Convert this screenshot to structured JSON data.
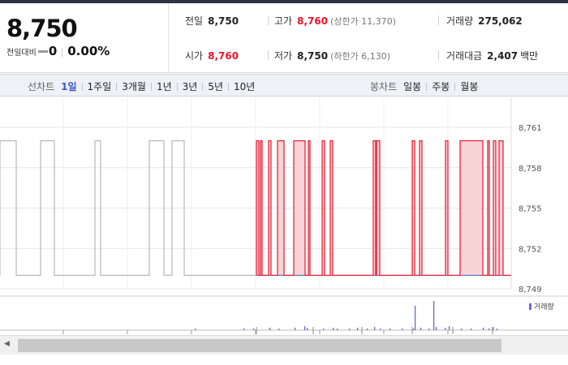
{
  "quote": {
    "price": "8,750",
    "change_label": "전일대비",
    "change_value": "0",
    "change_pct": "0.00%",
    "prev_close": {
      "label": "전일",
      "value": "8,750"
    },
    "open": {
      "label": "시가",
      "value": "8,760"
    },
    "high": {
      "label": "고가",
      "value": "8,760",
      "sub": "(상한가 11,370)"
    },
    "low": {
      "label": "저가",
      "value": "8,750",
      "sub": "(하한가 6,130)"
    },
    "volume": {
      "label": "거래량",
      "value": "275,062"
    },
    "amount": {
      "label": "거래대금",
      "value": "2,407",
      "unit": "백만"
    }
  },
  "toolbar": {
    "line_title": "선차트",
    "line_periods": [
      "1일",
      "1주일",
      "3개월",
      "1년",
      "3년",
      "5년",
      "10년"
    ],
    "candle_title": "봉차트",
    "candle_periods": [
      "일봉",
      "주봉",
      "월봉"
    ]
  },
  "chart_data": [
    {
      "type": "line",
      "title": "",
      "ylim": [
        8749,
        8761
      ],
      "yticks": [
        "8,761",
        "8,758",
        "8,755",
        "8,752",
        "8,749"
      ],
      "grid": true,
      "low": 8750,
      "high": 8760,
      "prev_session": {
        "color": "#aaaaaa",
        "high_intervals": [
          [
            0,
            20
          ],
          [
            50,
            67
          ],
          [
            117,
            124
          ],
          [
            184,
            202
          ],
          [
            212,
            227
          ]
        ]
      },
      "today": {
        "color": "#e8142a",
        "fill": "#f9d4d7",
        "base_color": "#3a5fc8",
        "start": 316,
        "end": 630,
        "high_intervals": [
          [
            316,
            319
          ],
          [
            321,
            323
          ],
          [
            331,
            334
          ],
          [
            342,
            350
          ],
          [
            362,
            376
          ],
          [
            380,
            382
          ],
          [
            397,
            400
          ],
          [
            407,
            410
          ],
          [
            460,
            463
          ],
          [
            464,
            468
          ],
          [
            508,
            511
          ],
          [
            517,
            520
          ],
          [
            549,
            552
          ],
          [
            567,
            595
          ],
          [
            601,
            603
          ],
          [
            608,
            611
          ],
          [
            615,
            620
          ]
        ]
      }
    },
    {
      "type": "bar",
      "title": "",
      "legend": "거래량",
      "color": "#6a6acd",
      "bars": [
        {
          "x": 240,
          "h": 2
        },
        {
          "x": 300,
          "h": 2
        },
        {
          "x": 312,
          "h": 2
        },
        {
          "x": 332,
          "h": 3
        },
        {
          "x": 343,
          "h": 2
        },
        {
          "x": 363,
          "h": 3
        },
        {
          "x": 375,
          "h": 5
        },
        {
          "x": 378,
          "h": 3
        },
        {
          "x": 398,
          "h": 2
        },
        {
          "x": 410,
          "h": 3
        },
        {
          "x": 415,
          "h": 2
        },
        {
          "x": 430,
          "h": 2
        },
        {
          "x": 440,
          "h": 3
        },
        {
          "x": 452,
          "h": 2
        },
        {
          "x": 461,
          "h": 4
        },
        {
          "x": 468,
          "h": 2
        },
        {
          "x": 480,
          "h": 2
        },
        {
          "x": 495,
          "h": 2
        },
        {
          "x": 509,
          "h": 2
        },
        {
          "x": 511,
          "h": 30
        },
        {
          "x": 518,
          "h": 3
        },
        {
          "x": 528,
          "h": 2
        },
        {
          "x": 534,
          "h": 36
        },
        {
          "x": 537,
          "h": 4
        },
        {
          "x": 548,
          "h": 3
        },
        {
          "x": 553,
          "h": 5
        },
        {
          "x": 568,
          "h": 2
        },
        {
          "x": 580,
          "h": 2
        },
        {
          "x": 595,
          "h": 3
        },
        {
          "x": 602,
          "h": 2
        },
        {
          "x": 607,
          "h": 4
        },
        {
          "x": 612,
          "h": 2
        }
      ]
    }
  ]
}
